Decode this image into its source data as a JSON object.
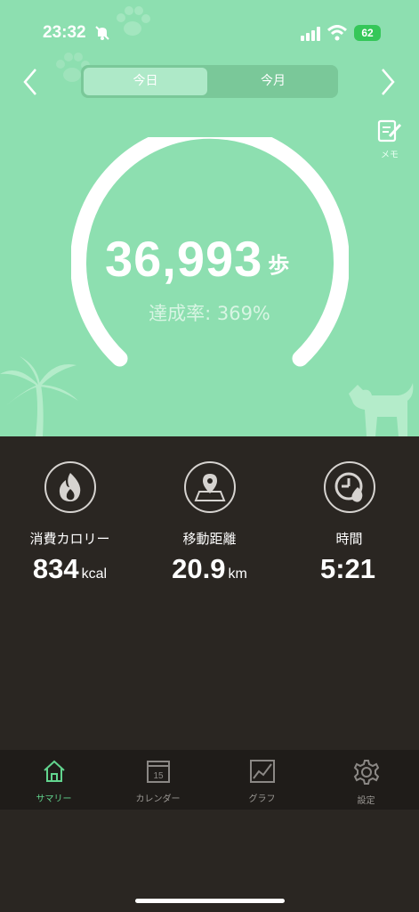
{
  "status_bar": {
    "time": "23:32",
    "battery": "62"
  },
  "segment": {
    "today": "今日",
    "month": "今月"
  },
  "memo": {
    "label": "メモ"
  },
  "steps": {
    "value": "36,993",
    "unit": "歩",
    "achievement": "達成率: 369%",
    "achievement_ratio": 3.69
  },
  "stats": [
    {
      "label": "消費カロリー",
      "value": "834",
      "unit": "kcal",
      "icon": "calorie-flame-icon"
    },
    {
      "label": "移動距離",
      "value": "20.9",
      "unit": "km",
      "icon": "map-pin-icon"
    },
    {
      "label": "時間",
      "value": "5:21",
      "unit": "",
      "icon": "clock-flame-icon"
    }
  ],
  "tabbar": {
    "summary": "サマリー",
    "calendar": "カレンダー",
    "calendar_day": "15",
    "graph": "グラフ",
    "settings": "設定"
  },
  "colors": {
    "header_bg": "#8ddfb0",
    "body_bg": "#2a2622",
    "active_tab": "#62d48e"
  }
}
